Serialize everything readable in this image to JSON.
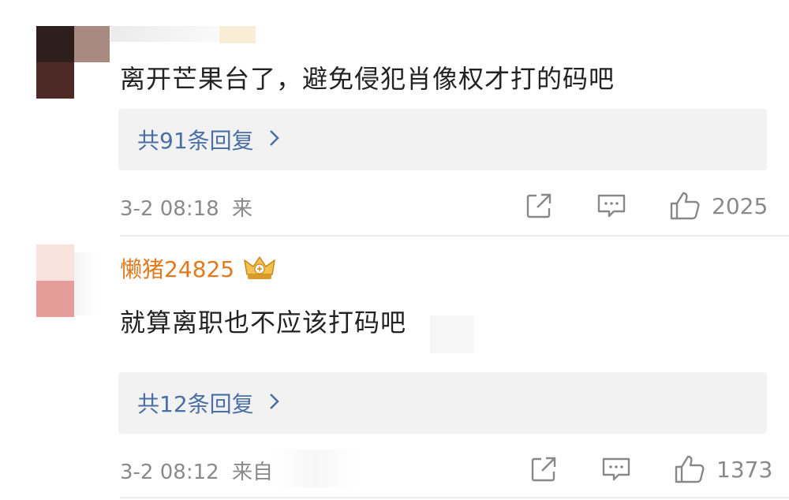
{
  "comments": [
    {
      "text": "离开芒果台了，避免侵犯肖像权才打的码吧",
      "reply_link": "共91条回复",
      "time": "3-2 08:18",
      "source": "来",
      "likes": "2025"
    },
    {
      "username": "懒猪24825",
      "text": "就算离职也不应该打码吧",
      "reply_link": "共12条回复",
      "time": "3-2 08:12",
      "source": "来自",
      "likes": "1373"
    }
  ],
  "icons": {
    "share": "share-icon",
    "comment": "comment-icon",
    "like": "thumbs-up-icon",
    "badge": "crown-badge-icon",
    "chevron": "chevron-right-icon"
  },
  "colors": {
    "username": "#e07a1f",
    "link": "#4a6fa5",
    "meta": "#8a8a8a",
    "reply_bg": "#f2f2f2"
  }
}
